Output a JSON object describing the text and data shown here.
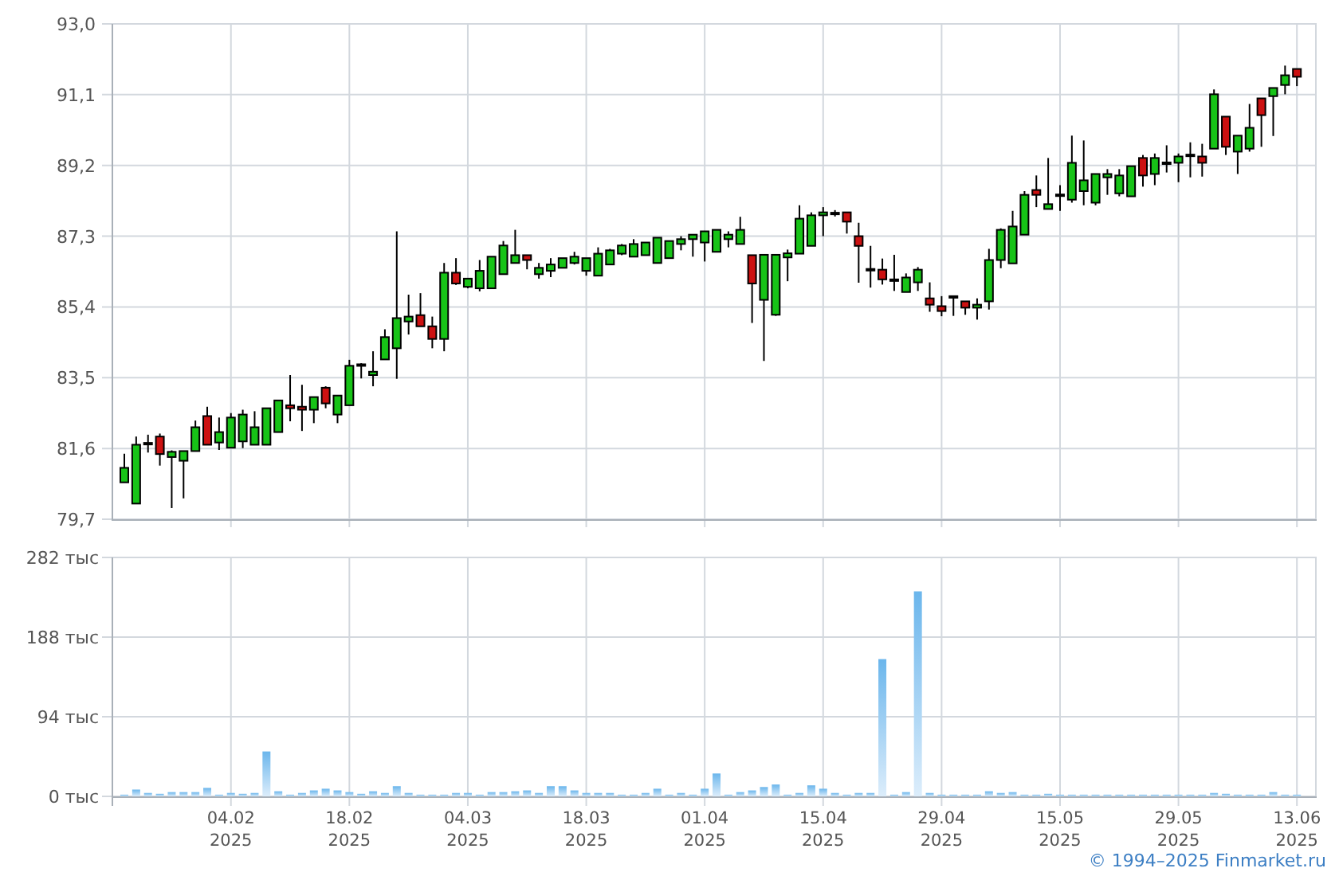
{
  "price_chart": {
    "chart_data": {
      "type": "candlestick",
      "grid": true,
      "categories": [
        null,
        null,
        null,
        null,
        null,
        null,
        null,
        null,
        null,
        null,
        null,
        null,
        null,
        null,
        null,
        null,
        null,
        null,
        null,
        null,
        null,
        null,
        null,
        null,
        null,
        null,
        null,
        null,
        null,
        null,
        null,
        null,
        null,
        null,
        null,
        null,
        null,
        null,
        null,
        null,
        null,
        null,
        null,
        null,
        null,
        null,
        null,
        null,
        null,
        null,
        null,
        null,
        null,
        null,
        null,
        null,
        null,
        null,
        null,
        null,
        null,
        null,
        null,
        null,
        null,
        null,
        null,
        null,
        null,
        null,
        null,
        null,
        null,
        null,
        null,
        null,
        null,
        null,
        null,
        null,
        null,
        null,
        null,
        null,
        null,
        null,
        null,
        null,
        null,
        null,
        null,
        null,
        null,
        null,
        null,
        null,
        null,
        null,
        null,
        null
      ],
      "ohlc": [
        [
          80.69,
          81.46,
          80.69,
          81.08
        ],
        [
          80.12,
          81.92,
          80.12,
          81.7
        ],
        [
          81.74,
          81.97,
          81.49,
          81.75
        ],
        [
          81.92,
          82.0,
          81.14,
          81.45
        ],
        [
          81.37,
          81.55,
          80.0,
          81.51
        ],
        [
          81.27,
          81.53,
          80.26,
          81.53
        ],
        [
          81.53,
          82.35,
          81.53,
          82.17
        ],
        [
          82.47,
          82.72,
          81.7,
          81.7
        ],
        [
          81.76,
          82.43,
          81.56,
          82.04
        ],
        [
          81.62,
          82.55,
          81.62,
          82.43
        ],
        [
          81.79,
          82.64,
          81.61,
          82.51
        ],
        [
          81.7,
          82.6,
          81.7,
          82.17
        ],
        [
          81.7,
          82.68,
          81.7,
          82.68
        ],
        [
          82.04,
          82.89,
          82.04,
          82.89
        ],
        [
          82.76,
          83.57,
          82.33,
          82.68
        ],
        [
          82.72,
          83.31,
          82.07,
          82.64
        ],
        [
          82.64,
          82.98,
          82.28,
          82.98
        ],
        [
          83.23,
          83.27,
          82.68,
          82.81
        ],
        [
          82.51,
          83.02,
          82.28,
          83.02
        ],
        [
          82.76,
          83.98,
          82.76,
          83.82
        ],
        [
          83.86,
          83.89,
          83.48,
          83.86
        ],
        [
          83.57,
          84.21,
          83.27,
          83.66
        ],
        [
          83.99,
          84.8,
          83.99,
          84.59
        ],
        [
          84.29,
          87.43,
          83.47,
          85.1
        ],
        [
          85.01,
          85.73,
          84.66,
          85.14
        ],
        [
          85.18,
          85.77,
          84.88,
          84.88
        ],
        [
          84.88,
          85.14,
          84.29,
          84.54
        ],
        [
          84.54,
          86.58,
          84.21,
          86.32
        ],
        [
          86.32,
          86.71,
          85.99,
          86.03
        ],
        [
          85.94,
          86.16,
          85.9,
          86.16
        ],
        [
          85.9,
          86.66,
          85.82,
          86.37
        ],
        [
          85.9,
          86.75,
          85.9,
          86.75
        ],
        [
          86.28,
          87.17,
          86.28,
          87.05
        ],
        [
          86.58,
          87.47,
          86.58,
          86.79
        ],
        [
          86.79,
          86.79,
          86.41,
          86.66
        ],
        [
          86.28,
          86.58,
          86.16,
          86.45
        ],
        [
          86.37,
          86.71,
          86.2,
          86.54
        ],
        [
          86.45,
          86.71,
          86.45,
          86.71
        ],
        [
          86.58,
          86.88,
          86.54,
          86.75
        ],
        [
          86.37,
          86.71,
          86.24,
          86.71
        ],
        [
          86.24,
          87.0,
          86.24,
          86.83
        ],
        [
          86.54,
          86.96,
          86.54,
          86.92
        ],
        [
          86.83,
          87.09,
          86.79,
          87.05
        ],
        [
          86.75,
          87.22,
          86.75,
          87.09
        ],
        [
          86.79,
          87.13,
          86.79,
          87.13
        ],
        [
          86.58,
          87.26,
          86.58,
          87.26
        ],
        [
          86.71,
          87.17,
          86.71,
          87.17
        ],
        [
          87.09,
          87.3,
          86.92,
          87.22
        ],
        [
          87.22,
          87.34,
          86.75,
          87.34
        ],
        [
          87.13,
          87.43,
          86.62,
          87.43
        ],
        [
          86.88,
          87.47,
          86.88,
          87.47
        ],
        [
          87.22,
          87.43,
          87.0,
          87.34
        ],
        [
          87.09,
          87.82,
          87.09,
          87.47
        ],
        [
          86.79,
          86.79,
          84.97,
          86.03
        ],
        [
          85.59,
          86.8,
          83.95,
          86.8
        ],
        [
          85.19,
          86.8,
          85.16,
          86.8
        ],
        [
          86.73,
          86.94,
          86.09,
          86.84
        ],
        [
          86.83,
          88.13,
          86.83,
          87.77
        ],
        [
          87.04,
          87.94,
          87.04,
          87.86
        ],
        [
          87.86,
          88.08,
          87.3,
          87.94
        ],
        [
          87.92,
          88.0,
          87.83,
          87.93
        ],
        [
          87.94,
          87.94,
          87.37,
          87.69
        ],
        [
          87.3,
          87.66,
          86.05,
          87.04
        ],
        [
          86.42,
          87.04,
          85.92,
          86.41
        ],
        [
          86.4,
          86.7,
          86.0,
          86.14
        ],
        [
          86.14,
          86.8,
          85.83,
          86.13
        ],
        [
          85.8,
          86.3,
          85.8,
          86.19
        ],
        [
          86.06,
          86.47,
          85.83,
          86.4
        ],
        [
          85.63,
          86.06,
          85.27,
          85.46
        ],
        [
          85.42,
          85.69,
          85.15,
          85.29
        ],
        [
          85.69,
          85.69,
          85.16,
          85.69
        ],
        [
          85.55,
          85.55,
          85.19,
          85.38
        ],
        [
          85.38,
          85.63,
          85.06,
          85.46
        ],
        [
          85.55,
          86.96,
          85.33,
          86.66
        ],
        [
          86.66,
          87.51,
          86.44,
          87.47
        ],
        [
          86.57,
          87.98,
          86.57,
          87.56
        ],
        [
          87.34,
          88.51,
          87.34,
          88.41
        ],
        [
          88.54,
          88.93,
          88.08,
          88.41
        ],
        [
          88.03,
          89.4,
          88.03,
          88.16
        ],
        [
          88.41,
          88.67,
          87.98,
          88.42
        ],
        [
          88.28,
          90.0,
          88.2,
          89.27
        ],
        [
          88.51,
          89.87,
          88.13,
          88.8
        ],
        [
          88.2,
          88.97,
          88.13,
          88.97
        ],
        [
          88.88,
          89.1,
          88.41,
          88.97
        ],
        [
          88.45,
          89.1,
          88.37,
          88.93
        ],
        [
          88.37,
          89.18,
          88.37,
          89.18
        ],
        [
          89.4,
          89.48,
          88.63,
          88.93
        ],
        [
          88.97,
          89.52,
          88.67,
          89.4
        ],
        [
          89.28,
          89.74,
          89.01,
          89.28
        ],
        [
          89.27,
          89.52,
          88.75,
          89.44
        ],
        [
          89.48,
          89.82,
          88.88,
          89.49
        ],
        [
          89.44,
          89.78,
          88.9,
          89.27
        ],
        [
          89.65,
          91.24,
          89.65,
          91.11
        ],
        [
          90.51,
          90.51,
          89.48,
          89.7
        ],
        [
          89.57,
          90.0,
          88.97,
          90.0
        ],
        [
          89.65,
          90.85,
          89.57,
          90.21
        ],
        [
          91.0,
          91.0,
          89.7,
          90.55
        ],
        [
          91.06,
          91.28,
          89.99,
          91.28
        ],
        [
          91.36,
          91.88,
          91.11,
          91.62
        ],
        [
          91.79,
          91.79,
          91.33,
          91.58
        ]
      ],
      "ylim": [
        79.7,
        93.0
      ],
      "yticks": [
        {
          "value": 79.7,
          "label": "79,7"
        },
        {
          "value": 81.6,
          "label": "81,6"
        },
        {
          "value": 83.5,
          "label": "83,5"
        },
        {
          "value": 85.4,
          "label": "85,4"
        },
        {
          "value": 87.3,
          "label": "87,3"
        },
        {
          "value": 89.2,
          "label": "89,2"
        },
        {
          "value": 91.1,
          "label": "91,1"
        },
        {
          "value": 93.0,
          "label": "93,0"
        }
      ]
    }
  },
  "volume_chart": {
    "chart_data": {
      "type": "bar",
      "grid": true,
      "categories": [
        null,
        null,
        null,
        null,
        null,
        null,
        null,
        null,
        null,
        "04.02 2025",
        null,
        null,
        null,
        null,
        null,
        null,
        null,
        null,
        null,
        "18.02 2025",
        null,
        null,
        null,
        null,
        null,
        null,
        null,
        null,
        null,
        "04.03 2025",
        null,
        null,
        null,
        null,
        null,
        null,
        null,
        null,
        null,
        "18.03 2025",
        null,
        null,
        null,
        null,
        null,
        null,
        null,
        null,
        null,
        "01.04 2025",
        null,
        null,
        null,
        null,
        null,
        null,
        null,
        null,
        null,
        "15.04 2025",
        null,
        null,
        null,
        null,
        null,
        null,
        null,
        null,
        null,
        "29.04 2025",
        null,
        null,
        null,
        null,
        null,
        null,
        null,
        null,
        null,
        "15.05 2025",
        null,
        null,
        null,
        null,
        null,
        null,
        null,
        null,
        null,
        "29.05 2025",
        null,
        null,
        null,
        null,
        null,
        null,
        null,
        null,
        null,
        "13.06 2025"
      ],
      "values": [
        2,
        8,
        4,
        3,
        5,
        5,
        5,
        10,
        2,
        4,
        3,
        4,
        53,
        6,
        2,
        4,
        7,
        9,
        7,
        5,
        3,
        6,
        4,
        12,
        4,
        2,
        2,
        2,
        4,
        4,
        2,
        5,
        5,
        6,
        7,
        4,
        12,
        12,
        7,
        4,
        4,
        4,
        2,
        2,
        4,
        9,
        2,
        4,
        2,
        9,
        27,
        2,
        5,
        7,
        11,
        14,
        2,
        4,
        13,
        9,
        4,
        2,
        4,
        4,
        162,
        2,
        5,
        242,
        4,
        2,
        2,
        2,
        2,
        6,
        4,
        5,
        2,
        2,
        3,
        2,
        2,
        2,
        2,
        2,
        2,
        2,
        2,
        2,
        2,
        2,
        2,
        2,
        4,
        3,
        2,
        2,
        2,
        5,
        2,
        2
      ],
      "ylim": [
        0,
        282
      ],
      "yticks": [
        {
          "value": 0,
          "label": "0 тыс"
        },
        {
          "value": 94,
          "label": "94 тыс"
        },
        {
          "value": 188,
          "label": "188 тыс"
        },
        {
          "value": 282,
          "label": "282 тыс"
        }
      ]
    }
  },
  "copyright": "© 1994–2025 Finmarket.ru"
}
